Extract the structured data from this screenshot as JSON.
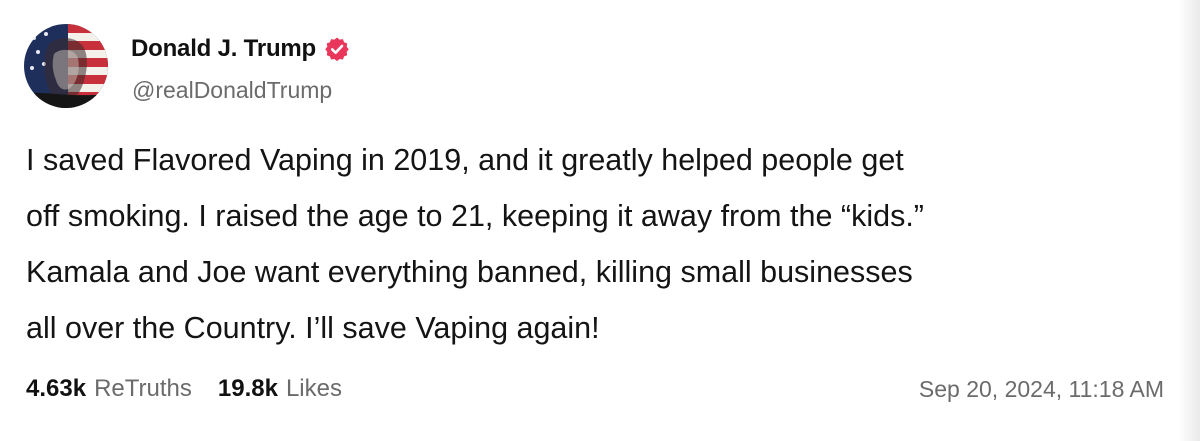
{
  "post": {
    "author": {
      "display_name": "Donald J. Trump",
      "handle": "@realDonaldTrump",
      "verified_icon": "verified-badge-icon",
      "verified_color": "#e8375a"
    },
    "text_lines": [
      "I saved Flavored Vaping in 2019, and it greatly helped people get",
      "off smoking. I raised the age to 21, keeping it away from the “kids.”",
      "Kamala and Joe want everything banned, killing small businesses",
      "all over the Country. I’ll save Vaping again!"
    ],
    "stats": {
      "retruths_count": "4.63k",
      "retruths_label": "ReTruths",
      "likes_count": "19.8k",
      "likes_label": "Likes"
    },
    "timestamp": "Sep 20, 2024, 11:18 AM"
  }
}
